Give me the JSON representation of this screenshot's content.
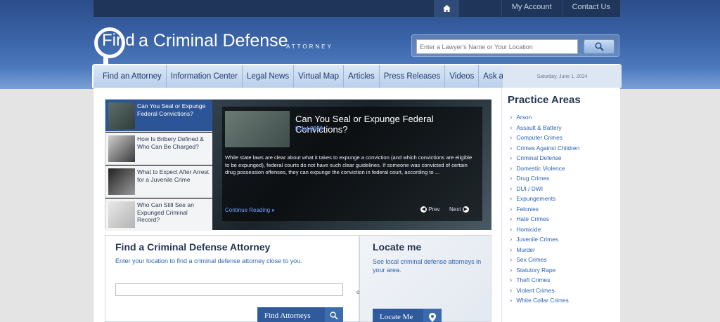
{
  "topbar": {
    "links": [
      "My Account",
      "Contact Us"
    ]
  },
  "logo": {
    "find": "Find",
    "rest": "a Criminal Defense",
    "sub": "ATTORNEY"
  },
  "search": {
    "placeholder": "Enter a Lawyer's Name or Your Location"
  },
  "nav": {
    "items": [
      "Find an Attorney",
      "Information Center",
      "Legal News",
      "Virtual Map",
      "Articles",
      "Press Releases",
      "Videos",
      "Ask an Attorney"
    ],
    "date": "Saturday, June 1, 2024"
  },
  "featured": {
    "thumbs": [
      {
        "title": "Can You Seal or Expunge Federal Convictions?"
      },
      {
        "title": "How Is Bribery Defined & Who Can Be Charged?"
      },
      {
        "title": "What to Expect After Arrest for a Juvenile Crime"
      },
      {
        "title": "Who Can Still See an Expunged Criminal Record?"
      }
    ],
    "main": {
      "title": "Can You Seal or Expunge Federal Convictions?",
      "date": "5-Jul-2020",
      "text": "While state laws are clear about what it takes to expunge a conviction (and which convictions are eligible to be expunged), federal courts do not have such clear guidelines. If someone was convicted of certain drug possession offenses, they can expunge the conviction in federal court, according to ...",
      "more": "Continue Reading",
      "prev": "Prev",
      "next": "Next"
    }
  },
  "find": {
    "title": "Find a Criminal Defense Attorney",
    "desc": "Enter your location to find a criminal defense attorney close to you.",
    "or": "or",
    "button": "Find Attorneys"
  },
  "locate": {
    "title": "Locate me",
    "desc": "See local criminal defense attorneys in your area.",
    "button": "Locate Me"
  },
  "practice": {
    "title": "Practice Areas",
    "items": [
      "Arson",
      "Assault & Battery",
      "Computer Crimes",
      "Crimes Against Children",
      "Criminal Defense",
      "Domestic Violence",
      "Drug Crimes",
      "DUI / DWI",
      "Expungements",
      "Felonies",
      "Hate Crimes",
      "Homicide",
      "Juvenile Crimes",
      "Murder",
      "Sex Crimes",
      "Statutory Rape",
      "Theft Crimes",
      "Violent Crimes",
      "White Collar Crimes"
    ]
  }
}
